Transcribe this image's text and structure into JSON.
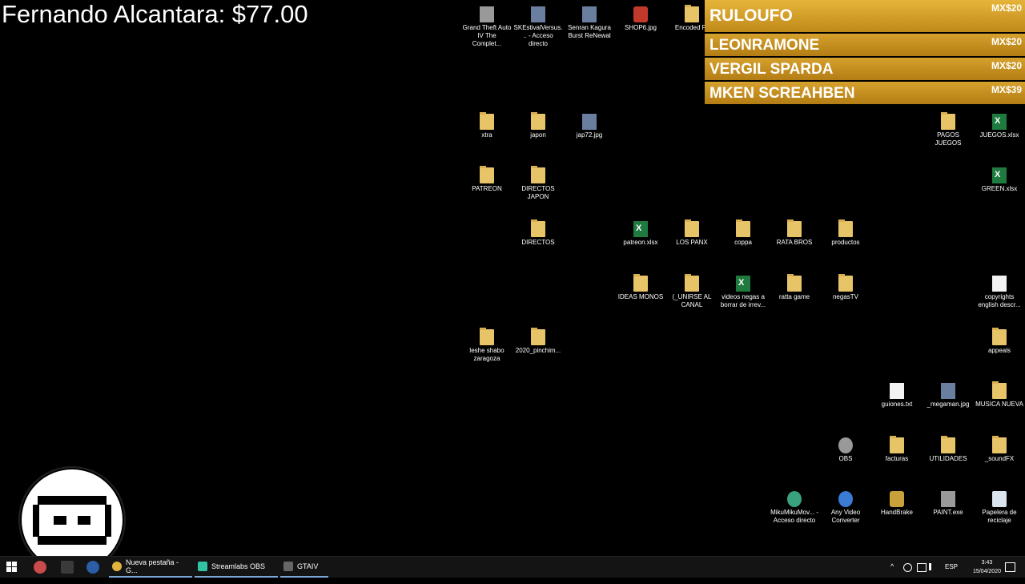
{
  "overlay": {
    "title": "Fernando Alcantara: $77.00"
  },
  "donations": [
    {
      "name": "RULOUFO",
      "amount": "MX$20"
    },
    {
      "name": "LEONRAMONE",
      "amount": "MX$20"
    },
    {
      "name": "VERGIL SPARDA",
      "amount": "MX$20"
    },
    {
      "name": "MKEN SCREAHBEN",
      "amount": "MX$39"
    }
  ],
  "desktop": {
    "icons": {
      "gta": "Grand Theft Auto IV The Complet...",
      "skestival": "SKEstivalVersus... - Acceso directo",
      "senran": "Senran Kagura Burst ReNewal",
      "shop6": "SHOP6.jpg",
      "encoded": "Encoded Fil",
      "xtra": "xtra",
      "japon": "japon",
      "jap72": "jap72.jpg",
      "pagos": "PAGOS JUEGOS",
      "juegos": "JUEGOS.xlsx",
      "patreon": "PATREON",
      "directos_japon": "DIRECTOS JAPON",
      "green": "GREEN.xlsx",
      "directos": "DIRECTOS",
      "patreon_xlsx": "patreon.xlsx",
      "los_panx": "LOS PANX",
      "coppa": "coppa",
      "rata_bros": "RATA BROS",
      "productos": "productos",
      "ideas_monos": "IDEAS MONOS",
      "unirse": "(_UNIRSE AL CANAL",
      "videos_negas": "videos negas a borrar de irrev...",
      "ratta_game": "ratta game",
      "negas_tv": "negasTV",
      "copyrights": "copyrights english descr...",
      "leshe": "leshe shabo zaragoza",
      "pinchim": "2020_pinchim...",
      "appeals": "appeals",
      "guiones": "guiones.txt",
      "megaman": "_megaman.jpg",
      "musica": "MUSICA NUEVA",
      "obs": "OBS",
      "facturas": "facturas",
      "utilidades": "UTILIDADES",
      "soundfx": "_soundFX",
      "miku": "MikuMikuMov... - Acceso directo",
      "any_video": "Any Video Converter",
      "handbrake": "HandBrake",
      "paint": "PAINT.exe",
      "papelera": "Papelera de reciclaje"
    }
  },
  "taskbar": {
    "apps": [
      {
        "label": "Nueva pestaña - G..."
      },
      {
        "label": "Streamlabs OBS"
      },
      {
        "label": "GTAIV"
      }
    ],
    "language": "ESP",
    "time": "3:43",
    "date": "15/04/2020"
  }
}
